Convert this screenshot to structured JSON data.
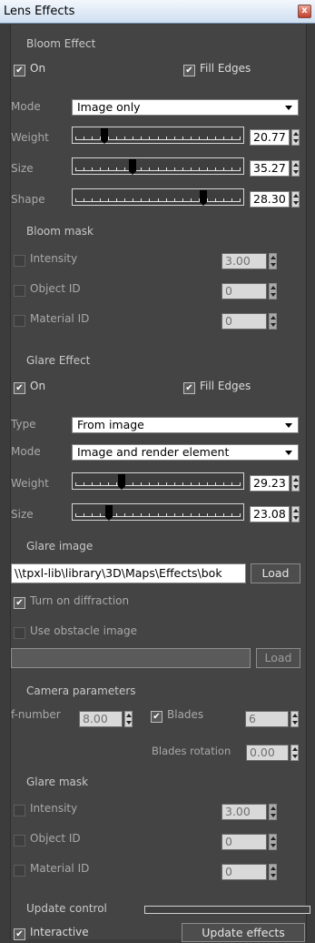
{
  "window": {
    "title": "Lens Effects",
    "close_glyph": "x"
  },
  "bloom": {
    "header": "Bloom Effect",
    "on_label": "On",
    "on_checked": true,
    "fill_edges_label": "Fill Edges",
    "fill_edges_checked": true,
    "mode_label": "Mode",
    "mode_value": "Image only",
    "weight_label": "Weight",
    "weight_value": "20.77",
    "weight_level": 0.16,
    "size_label": "Size",
    "size_value": "35.27",
    "size_level": 0.34,
    "shape_label": "Shape",
    "shape_value": "28.30",
    "shape_level": 0.79
  },
  "bloom_mask": {
    "header": "Bloom mask",
    "intensity_label": "Intensity",
    "intensity_value": "3.00",
    "object_id_label": "Object ID",
    "object_id_value": "0",
    "material_id_label": "Material ID",
    "material_id_value": "0"
  },
  "glare": {
    "header": "Glare Effect",
    "on_label": "On",
    "on_checked": true,
    "fill_edges_label": "Fill Edges",
    "fill_edges_checked": true,
    "type_label": "Type",
    "type_value": "From image",
    "mode_label": "Mode",
    "mode_value": "Image and render element",
    "weight_label": "Weight",
    "weight_value": "29.23",
    "weight_level": 0.27,
    "size_label": "Size",
    "size_value": "23.08",
    "size_level": 0.19
  },
  "glare_image": {
    "header": "Glare image",
    "path_value": "\\\\tpxl-lib\\library\\3D\\Maps\\Effects\\bok",
    "load_label": "Load",
    "diffraction_label": "Turn on diffraction",
    "diffraction_checked": true,
    "obstacle_label": "Use obstacle image",
    "obstacle_checked": false,
    "obstacle_path_value": "",
    "obstacle_load_label": "Load"
  },
  "camera": {
    "header": "Camera parameters",
    "fnumber_label": "f-number",
    "fnumber_value": "8.00",
    "blades_label": "Blades",
    "blades_checked": true,
    "blades_value": "6",
    "blades_rotation_label": "Blades rotation",
    "blades_rotation_value": "0.00"
  },
  "glare_mask": {
    "header": "Glare mask",
    "intensity_label": "Intensity",
    "intensity_value": "3.00",
    "object_id_label": "Object ID",
    "object_id_value": "0",
    "material_id_label": "Material ID",
    "material_id_value": "0"
  },
  "update": {
    "header": "Update control",
    "progress": 0,
    "interactive_label": "Interactive",
    "interactive_checked": true,
    "update_button_label": "Update effects"
  },
  "colors": {
    "panel": "#444444",
    "background": "#3c3c3c",
    "titlebar": "#dbe6f4",
    "progress_fill": "#7aa6d6"
  },
  "icons": {
    "checkmark": "checkmark-icon",
    "close": "close-icon",
    "dropdown": "chevron-down-icon",
    "spinner": "spinner-arrows-icon"
  }
}
